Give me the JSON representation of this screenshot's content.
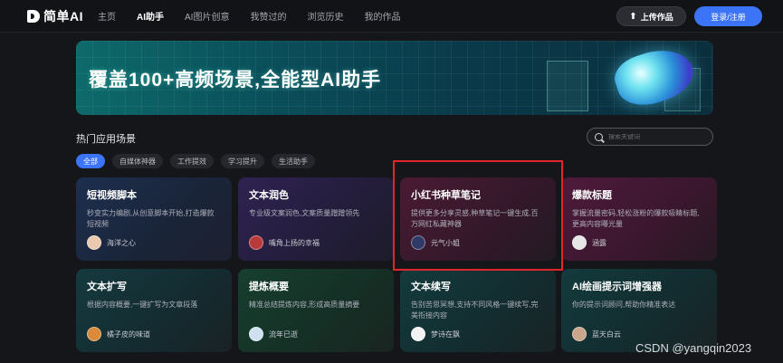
{
  "app": {
    "name": "简单AI"
  },
  "nav": {
    "items": [
      {
        "label": "主页",
        "active": false
      },
      {
        "label": "AI助手",
        "active": true
      },
      {
        "label": "AI图片创意",
        "active": false
      },
      {
        "label": "我赞过的",
        "active": false
      },
      {
        "label": "浏览历史",
        "active": false
      },
      {
        "label": "我的作品",
        "active": false
      }
    ],
    "upload_label": "上传作品",
    "login_label": "登录/注册"
  },
  "banner": {
    "title": "覆盖100+高频场景,全能型AI助手"
  },
  "section": {
    "title": "热门应用场景",
    "search_placeholder": "搜索关键词"
  },
  "filters": [
    {
      "label": "全部",
      "active": true
    },
    {
      "label": "自媒体神器",
      "active": false
    },
    {
      "label": "工作提效",
      "active": false
    },
    {
      "label": "学习提升",
      "active": false
    },
    {
      "label": "生活助手",
      "active": false
    }
  ],
  "cards": [
    {
      "title": "短视频脚本",
      "desc": "秒变实力编剧,从创意脚本开始,打造爆款短视频",
      "author": "海洋之心",
      "theme": "bg-blue",
      "avatar_color": "#e9c9b0"
    },
    {
      "title": "文本润色",
      "desc": "专业级文案润色,文案质量蹭蹭领先",
      "author": "嘴角上扬的幸福",
      "theme": "bg-purple",
      "avatar_color": "#b83a3a"
    },
    {
      "title": "小红书种草笔记",
      "desc": "提供更多分享灵感,种草笔记一键生成,百万网红私藏神器",
      "author": "元气小姐",
      "theme": "bg-red",
      "avatar_color": "#2f3a66"
    },
    {
      "title": "爆款标题",
      "desc": "掌握流量密码,轻松涨粉的爆款吸睛标题,更高内容曝光量",
      "author": "涵露",
      "theme": "bg-magenta",
      "avatar_color": "#e6e6e6"
    },
    {
      "title": "文本扩写",
      "desc": "根据内容概要,一键扩写为文章段落",
      "author": "橘子皮的味道",
      "theme": "bg-teal",
      "avatar_color": "#d98a3a"
    },
    {
      "title": "提炼概要",
      "desc": "精准总结提炼内容,形成高质量摘要",
      "author": "流年已逝",
      "theme": "bg-green",
      "avatar_color": "#cfe0ee"
    },
    {
      "title": "文本续写",
      "desc": "告别苦思冥想,支持不同风格一键续写,完美衔接内容",
      "author": "梦诗在飘",
      "theme": "bg-teal2",
      "avatar_color": "#f2f2f2"
    },
    {
      "title": "AI绘画提示词增强器",
      "desc": "你的提示词顾问,帮助你精准表达",
      "author": "蓝天白云",
      "theme": "bg-teal2",
      "avatar_color": "#c9a58a"
    }
  ],
  "watermark": "CSDN @yangqin2023"
}
